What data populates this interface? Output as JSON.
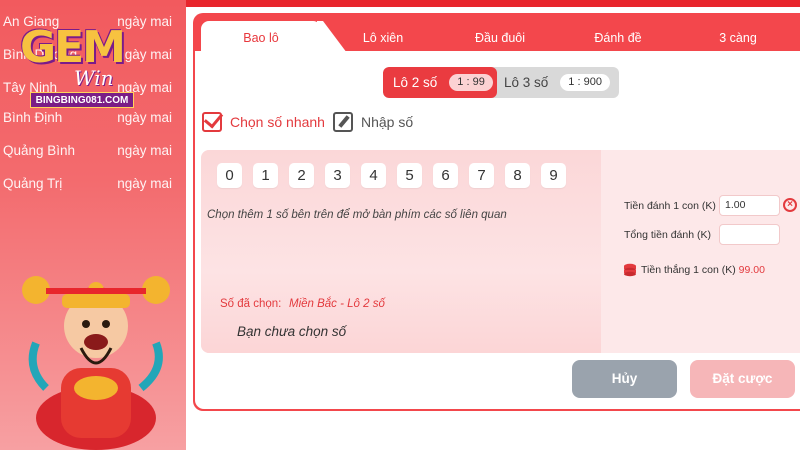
{
  "sidebar": {
    "rows": [
      {
        "province": "An Giang",
        "day": "ngày mai"
      },
      {
        "province": "Bình Dương",
        "day": "ngày mai"
      },
      {
        "province": "Tây Ninh",
        "day": "ngày mai"
      },
      {
        "province": "Bình Định",
        "day": "ngày mai"
      },
      {
        "province": "Quảng Bình",
        "day": "ngày mai"
      },
      {
        "province": "Quảng Trị",
        "day": "ngày mai"
      }
    ],
    "logo": {
      "brand": "GEM",
      "sub": "Win",
      "banner": "BINGBING081.COM"
    }
  },
  "tabs": [
    {
      "label": "Bao lô",
      "active": true
    },
    {
      "label": "Lô xiên"
    },
    {
      "label": "Đầu đuôi"
    },
    {
      "label": "Đánh đề"
    },
    {
      "label": "3 càng"
    }
  ],
  "switch": {
    "a": {
      "label": "Lô 2 số",
      "ratio": "1 : 99"
    },
    "b": {
      "label": "Lô 3 số",
      "ratio": "1 : 900"
    }
  },
  "options": {
    "quick": "Chọn số nhanh",
    "manual": "Nhập số"
  },
  "digits": [
    "0",
    "1",
    "2",
    "3",
    "4",
    "5",
    "6",
    "7",
    "8",
    "9"
  ],
  "hint": "Chọn thêm 1 số bên trên để mở bàn phím các số liên quan",
  "form": {
    "stake_label": "Tiền đánh 1 con (K)",
    "stake_value": "1.00",
    "total_label": "Tổng tiền đánh (K)",
    "total_value": "",
    "win_label": "Tiền thắng 1 con (K)",
    "win_value": "99.00"
  },
  "selection": {
    "label": "Số đã chọn:",
    "value": "Miền Bắc - Lô 2 số",
    "empty": "Bạn chưa chọn số"
  },
  "buttons": {
    "cancel": "Hủy",
    "bet": "Đặt cược"
  },
  "colors": {
    "accent": "#e8373c",
    "cancel": "#9aa3ad",
    "bet_disabled": "#f6b6b8"
  }
}
